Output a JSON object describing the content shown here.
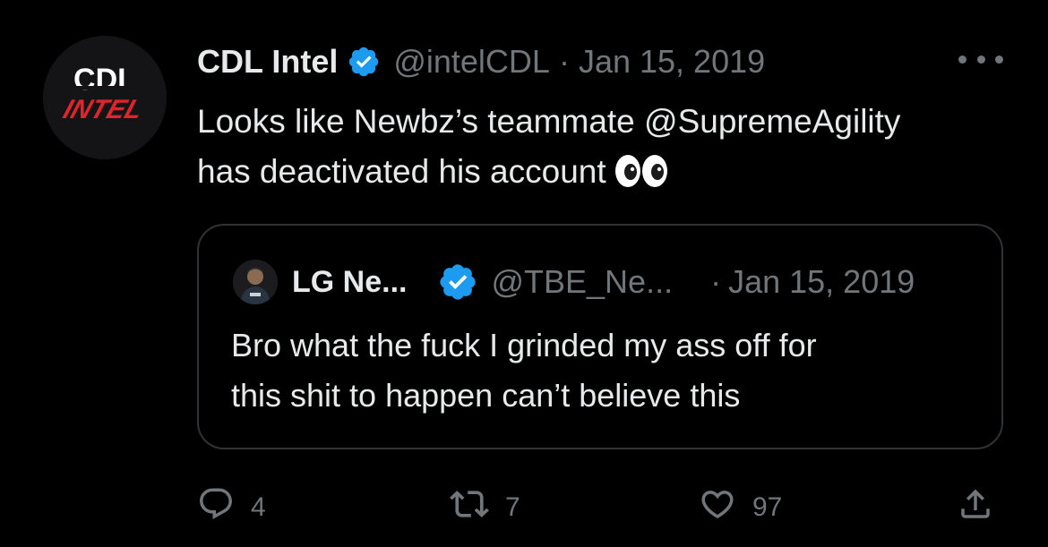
{
  "tweet": {
    "display_name": "CDL Intel",
    "handle": "@intelCDL",
    "separator": "·",
    "date": "Jan 15, 2019",
    "avatar_text_top": "CDL",
    "avatar_text_bottom": "INTEL",
    "body_lines": [
      "Looks like Newbz’s teammate @SupremeAgility",
      "has deactivated his account"
    ],
    "emoji": "eyes-emoji"
  },
  "quote": {
    "display_name": "LG Ne...",
    "handle": "@TBE_Ne...",
    "separator": "·",
    "date": "Jan 15, 2019",
    "body_lines": [
      "Bro what the fuck I grinded my ass off for",
      "this shit to happen can’t believe this"
    ]
  },
  "actions": {
    "reply_count": "4",
    "retweet_count": "7",
    "like_count": "97"
  },
  "colors": {
    "background": "#000000",
    "text_primary": "#e7e9ea",
    "text_secondary": "#71767b",
    "verified_blue": "#1d9bf0",
    "border": "#2f3336",
    "avatar_red": "#e0242b"
  },
  "icons": {
    "reply": "reply-icon",
    "retweet": "retweet-icon",
    "like": "heart-icon",
    "share": "share-icon",
    "more": "more-icon",
    "verified": "verified-badge-icon"
  }
}
